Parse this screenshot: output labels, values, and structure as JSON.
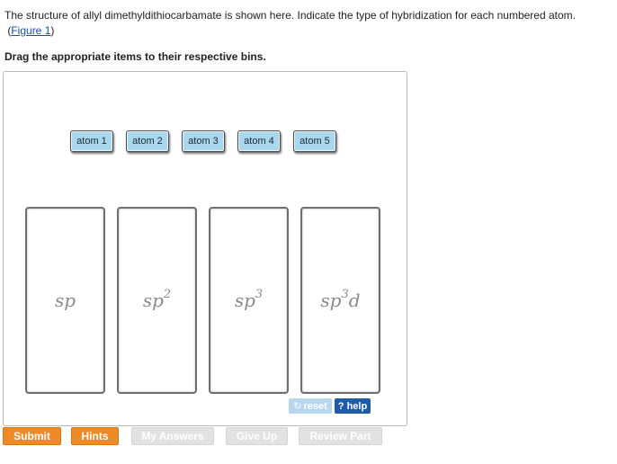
{
  "question": {
    "text": "The structure of allyl dimethyldithiocarbamate is shown here. Indicate the type of hybridization for each numbered atom.",
    "figure_open": "(",
    "figure_link": "Figure 1",
    "figure_close": ")"
  },
  "instruction": "Drag the appropriate items to their respective bins.",
  "atoms": [
    "atom 1",
    "atom 2",
    "atom 3",
    "atom 4",
    "atom 5"
  ],
  "bins": [
    {
      "base": "sp",
      "sup": ""
    },
    {
      "base": "sp",
      "sup": "2"
    },
    {
      "base": "sp",
      "sup": "3"
    },
    {
      "base": "sp",
      "sup": "3",
      "tail": "d"
    }
  ],
  "controls": {
    "reset": "reset",
    "help": "? help"
  },
  "actions": {
    "submit": "Submit",
    "hints": "Hints",
    "my_answers": "My Answers",
    "give_up": "Give Up",
    "review_part": "Review Part"
  },
  "colors": {
    "accent_orange": "#f08a24",
    "chip_blue": "#a9d7ee",
    "help_blue": "#1f5ca8",
    "link": "#1a4e9a"
  }
}
